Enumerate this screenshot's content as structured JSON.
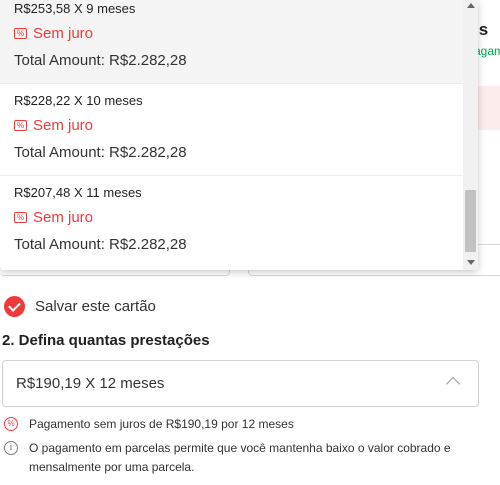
{
  "background": {
    "heading_fragment": "is",
    "link_fragment": "agam"
  },
  "dropdown": {
    "options": [
      {
        "title": "R$253,58 X 9 meses",
        "badge": "Sem juro",
        "total": "Total Amount: R$2.282,28"
      },
      {
        "title": "R$228,22 X 10 meses",
        "badge": "Sem juro",
        "total": "Total Amount: R$2.282,28"
      },
      {
        "title": "R$207,48 X 11 meses",
        "badge": "Sem juro",
        "total": "Total Amount: R$2.282,28"
      }
    ]
  },
  "save_card": {
    "label": "Salvar este cartão",
    "checked": true
  },
  "installments": {
    "section_title": "2. Defina quantas prestações",
    "selected": "R$190,19 X 12 meses",
    "interest_note": "Pagamento sem juros de R$190,19 por 12 meses",
    "info_note": "O pagamento em parcelas permite que você mantenha baixo o valor cobrado e mensalmente por uma parcela."
  },
  "colors": {
    "accent": "#ee3a3a",
    "link_green": "#00a650",
    "border": "#cfcfcf"
  },
  "icons": {
    "badge": "discount-tag-icon",
    "percent": "percent-icon",
    "info": "info-icon",
    "chevron": "chevron-up-icon",
    "check": "check-circle-icon"
  }
}
